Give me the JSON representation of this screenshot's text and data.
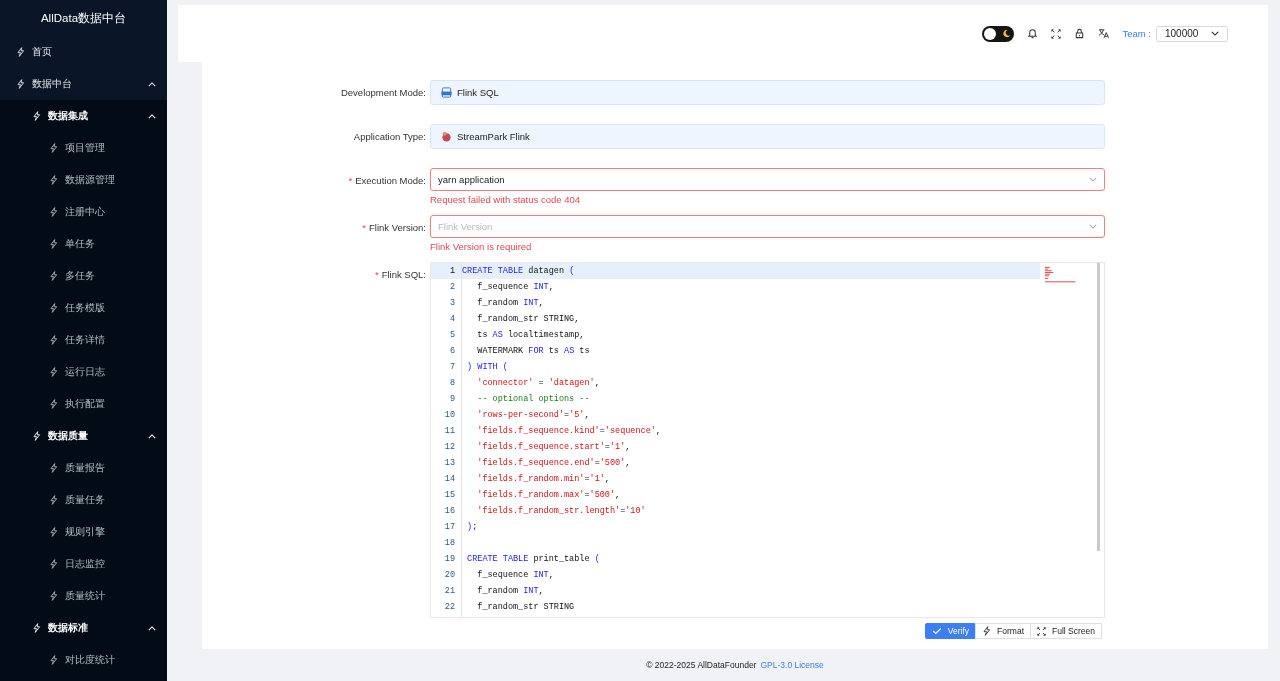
{
  "sidebar": {
    "logo": "AllData数据中台",
    "items": [
      {
        "label": "首页"
      },
      {
        "label": "数据中台",
        "expanded": true,
        "children": [
          {
            "label": "数据集成",
            "expanded": true,
            "children": [
              {
                "label": "项目管理"
              },
              {
                "label": "数据源管理"
              },
              {
                "label": "注册中心"
              },
              {
                "label": "单任务"
              },
              {
                "label": "多任务"
              },
              {
                "label": "任务模版"
              },
              {
                "label": "任务详情"
              },
              {
                "label": "运行日志"
              },
              {
                "label": "执行配置"
              }
            ]
          },
          {
            "label": "数据质量",
            "expanded": true,
            "children": [
              {
                "label": "质量报告"
              },
              {
                "label": "质量任务"
              },
              {
                "label": "规则引擎"
              },
              {
                "label": "日志监控"
              },
              {
                "label": "质量统计"
              }
            ]
          },
          {
            "label": "数据标准",
            "expanded": true,
            "children": [
              {
                "label": "对比度统计"
              }
            ]
          }
        ]
      }
    ]
  },
  "header": {
    "dark_mode": false,
    "team_label": "Team :",
    "team_value": "100000"
  },
  "form": {
    "fields": [
      {
        "kind": "static",
        "label": "Development Mode:",
        "value": "Flink SQL"
      },
      {
        "kind": "static",
        "label": "Application Type:",
        "value": "StreamPark Flink"
      },
      {
        "kind": "select",
        "required_mark": "*",
        "label": "Execution Mode:",
        "value": "yarn application",
        "error": "Request failed with status code 404"
      },
      {
        "kind": "select",
        "required_mark": "*",
        "label": "Flink Version:",
        "placeholder": "Flink Version",
        "error": "Flink Version is required"
      }
    ],
    "editor": {
      "required_mark": "*",
      "label": "Flink SQL:",
      "lines": [
        {
          "num": "1",
          "current": true,
          "tokens": [
            {
              "kind": "kw",
              "text": "CREATE TABLE"
            },
            {
              "kind": "plain",
              "text": " datagen "
            },
            {
              "kind": "kw",
              "text": "("
            }
          ]
        },
        {
          "num": "2",
          "current": false,
          "tokens": [
            {
              "kind": "plain",
              "text": "   f_sequence "
            },
            {
              "kind": "kw",
              "text": "INT"
            },
            {
              "kind": "plain",
              "text": ","
            }
          ]
        },
        {
          "num": "3",
          "current": false,
          "tokens": [
            {
              "kind": "plain",
              "text": "   f_random "
            },
            {
              "kind": "kw",
              "text": "INT"
            },
            {
              "kind": "plain",
              "text": ","
            }
          ]
        },
        {
          "num": "4",
          "current": false,
          "tokens": [
            {
              "kind": "plain",
              "text": "   f_random_str STRING,"
            }
          ]
        },
        {
          "num": "5",
          "current": false,
          "tokens": [
            {
              "kind": "plain",
              "text": "   ts "
            },
            {
              "kind": "kw",
              "text": "AS"
            },
            {
              "kind": "plain",
              "text": " localtimestamp,"
            }
          ]
        },
        {
          "num": "6",
          "current": false,
          "tokens": [
            {
              "kind": "plain",
              "text": "   WATERMARK "
            },
            {
              "kind": "kw",
              "text": "FOR"
            },
            {
              "kind": "plain",
              "text": " ts "
            },
            {
              "kind": "kw",
              "text": "AS"
            },
            {
              "kind": "plain",
              "text": " ts"
            }
          ]
        },
        {
          "num": "7",
          "current": false,
          "tokens": [
            {
              "kind": "kw",
              "text": " ) WITH ("
            }
          ]
        },
        {
          "num": "8",
          "current": false,
          "tokens": [
            {
              "kind": "str",
              "text": "   'connector'"
            },
            {
              "kind": "plain",
              "text": " = "
            },
            {
              "kind": "str",
              "text": "'datagen'"
            },
            {
              "kind": "plain",
              "text": ","
            }
          ]
        },
        {
          "num": "9",
          "current": false,
          "tokens": [
            {
              "kind": "comment",
              "text": "   -- optional options --"
            }
          ]
        },
        {
          "num": "10",
          "current": false,
          "tokens": [
            {
              "kind": "str",
              "text": "   'rows-per-second'"
            },
            {
              "kind": "plain",
              "text": "="
            },
            {
              "kind": "str",
              "text": "'5'"
            },
            {
              "kind": "plain",
              "text": ","
            }
          ]
        },
        {
          "num": "11",
          "current": false,
          "tokens": [
            {
              "kind": "str",
              "text": "   'fields.f_sequence.kind'"
            },
            {
              "kind": "plain",
              "text": "="
            },
            {
              "kind": "str",
              "text": "'sequence'"
            },
            {
              "kind": "plain",
              "text": ","
            }
          ]
        },
        {
          "num": "12",
          "current": false,
          "tokens": [
            {
              "kind": "str",
              "text": "   'fields.f_sequence.start'"
            },
            {
              "kind": "plain",
              "text": "="
            },
            {
              "kind": "str",
              "text": "'1'"
            },
            {
              "kind": "plain",
              "text": ","
            }
          ]
        },
        {
          "num": "13",
          "current": false,
          "tokens": [
            {
              "kind": "str",
              "text": "   'fields.f_sequence.end'"
            },
            {
              "kind": "plain",
              "text": "="
            },
            {
              "kind": "str",
              "text": "'500'"
            },
            {
              "kind": "plain",
              "text": ","
            }
          ]
        },
        {
          "num": "14",
          "current": false,
          "tokens": [
            {
              "kind": "str",
              "text": "   'fields.f_random.min'"
            },
            {
              "kind": "plain",
              "text": "="
            },
            {
              "kind": "str",
              "text": "'1'"
            },
            {
              "kind": "plain",
              "text": ","
            }
          ]
        },
        {
          "num": "15",
          "current": false,
          "tokens": [
            {
              "kind": "str",
              "text": "   'fields.f_random.max'"
            },
            {
              "kind": "plain",
              "text": "="
            },
            {
              "kind": "str",
              "text": "'500'"
            },
            {
              "kind": "plain",
              "text": ","
            }
          ]
        },
        {
          "num": "16",
          "current": false,
          "tokens": [
            {
              "kind": "str",
              "text": "   'fields.f_random_str.length'"
            },
            {
              "kind": "plain",
              "text": "="
            },
            {
              "kind": "str",
              "text": "'10'"
            }
          ]
        },
        {
          "num": "17",
          "current": false,
          "tokens": [
            {
              "kind": "kw",
              "text": " )"
            },
            {
              "kind": "plain",
              "text": ";"
            }
          ]
        },
        {
          "num": "18",
          "current": false
        },
        {
          "num": "19",
          "current": false,
          "tokens": [
            {
              "kind": "kw",
              "text": " CREATE TABLE"
            },
            {
              "kind": "plain",
              "text": " print_table "
            },
            {
              "kind": "kw",
              "text": "("
            }
          ]
        },
        {
          "num": "20",
          "current": false,
          "tokens": [
            {
              "kind": "plain",
              "text": "   f_sequence "
            },
            {
              "kind": "kw",
              "text": "INT"
            },
            {
              "kind": "plain",
              "text": ","
            }
          ]
        },
        {
          "num": "21",
          "current": false,
          "tokens": [
            {
              "kind": "plain",
              "text": "   f_random "
            },
            {
              "kind": "kw",
              "text": "INT"
            },
            {
              "kind": "plain",
              "text": ","
            }
          ]
        },
        {
          "num": "22",
          "current": false,
          "tokens": [
            {
              "kind": "plain",
              "text": "   f_random_str STRING"
            }
          ]
        }
      ],
      "buttons": [
        {
          "kind": "verify",
          "label": "Verify",
          "primary": true
        },
        {
          "kind": "format",
          "label": "Format",
          "primary": false
        },
        {
          "kind": "fullscreen",
          "label": "Full Screen",
          "primary": false
        }
      ]
    }
  },
  "footer": {
    "text": "© 2022-2025 AllDataFounder",
    "link": "GPL-3.0 License"
  }
}
